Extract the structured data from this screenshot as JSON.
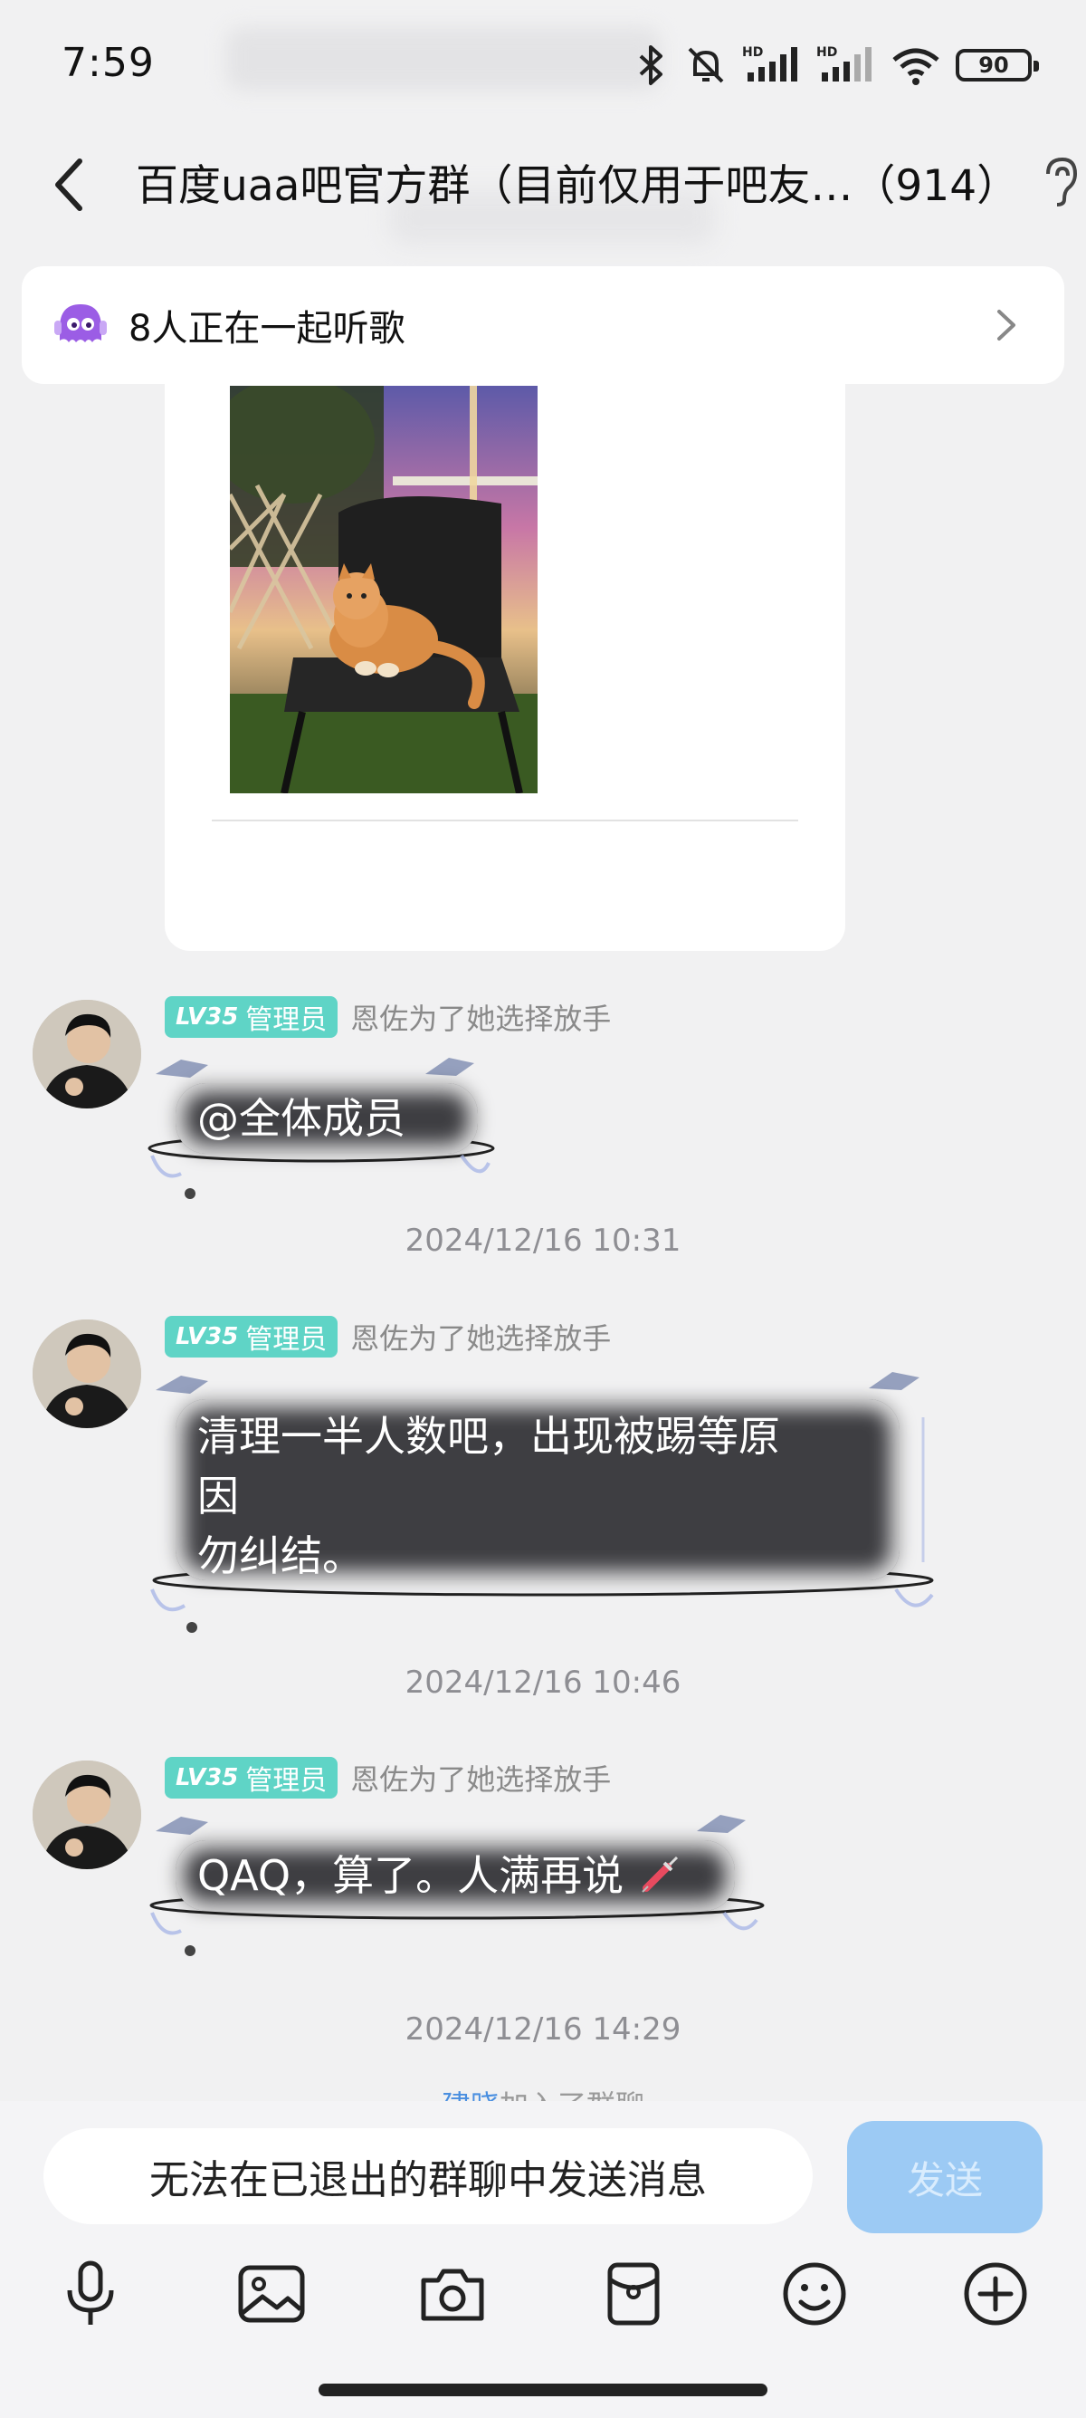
{
  "status_bar": {
    "time": "7:59",
    "battery": "90",
    "icons": [
      "bluetooth-icon",
      "mute-icon",
      "hd-signal-icon",
      "hd-signal-icon",
      "wifi-icon",
      "battery-icon"
    ]
  },
  "header": {
    "title": "百度uaa吧官方群（目前仅用于吧友…（914）",
    "icons": [
      "back-icon",
      "ear-icon"
    ]
  },
  "listen_banner": {
    "text": "8人正在一起听歌",
    "icons": [
      "music-buddy-icon",
      "chevron-right-icon"
    ]
  },
  "messages": [
    {
      "badge_level": "LV35",
      "badge_role": "管理员",
      "sender": "恩佐为了她选择放手",
      "text": "@全体成员"
    },
    {
      "timestamp": "2024/12/16 10:31"
    },
    {
      "badge_level": "LV35",
      "badge_role": "管理员",
      "sender": "恩佐为了她选择放手",
      "lines": [
        "清理一半人数吧，出现被踢等原",
        "因",
        "勿纠结。"
      ]
    },
    {
      "timestamp": "2024/12/16 10:46"
    },
    {
      "badge_level": "LV35",
      "badge_role": "管理员",
      "sender": "恩佐为了她选择放手",
      "text": "QAQ，算了。人满再说"
    },
    {
      "timestamp": "2024/12/16 14:29"
    }
  ],
  "system_peek": {
    "name": "建晓",
    "text": "加入了群聊"
  },
  "input": {
    "placeholder": "无法在已退出的群聊中发送消息",
    "send_label": "发送"
  },
  "toolbar": [
    "microphone-icon",
    "image-icon",
    "camera-icon",
    "red-packet-icon",
    "emoji-icon",
    "plus-icon"
  ],
  "colors": {
    "background": "#f1f1f2",
    "badge": "#5fd4c6",
    "bubble": "#3e3e42",
    "send_button": "#9ccaf4",
    "timestamp": "#8e8e93"
  }
}
